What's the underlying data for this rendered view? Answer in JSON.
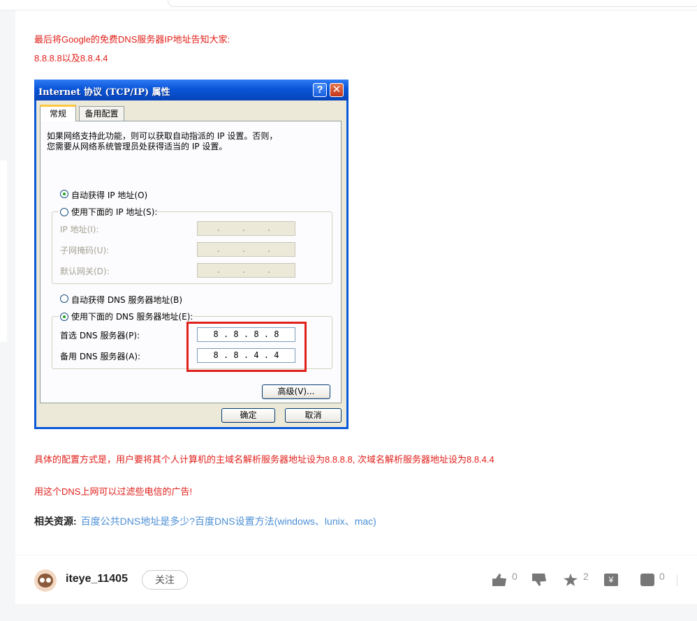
{
  "article": {
    "line1": "最后将Google的免费DNS服务器IP地址告知大家:",
    "line2": "8.8.8.8以及8.8.4.4",
    "line3": "具体的配置方式是，用户要将其个人计算机的主域名解析服务器地址设为8.8.8.8, 次域名解析服务器地址设为8.8.4.4",
    "line4": "用这个DNS上网可以过滤些电信的广告!",
    "related_label": "相关资源:",
    "related_link": "百度公共DNS地址是多少?百度DNS设置方法(windows、lunix、mac)"
  },
  "dialog": {
    "title": "Internet 协议 (TCP/IP) 属性",
    "help_glyph": "?",
    "close_glyph": "✕",
    "tab_general": "常规",
    "tab_alternate": "备用配置",
    "desc1": "如果网络支持此功能，则可以获取自动指派的 IP 设置。否则，",
    "desc2": "您需要从网络系统管理员处获得适当的 IP 设置。",
    "radio_auto_ip": "自动获得 IP 地址(O)",
    "radio_manual_ip": "使用下面的 IP 地址(S):",
    "label_ip": "IP 地址(I):",
    "label_mask": "子网掩码(U):",
    "label_gateway": "默认网关(D):",
    "empty_ip": " .    .    .  ",
    "radio_auto_dns": "自动获得 DNS 服务器地址(B)",
    "radio_manual_dns": "使用下面的 DNS 服务器地址(E):",
    "label_dns1": "首选 DNS 服务器(P):",
    "label_dns2": "备用 DNS 服务器(A):",
    "dns1_value": "8 . 8 . 8 . 8",
    "dns2_value": "8 . 8 . 4 . 4",
    "advanced_button": "高级(V)...",
    "ok_button": "确定",
    "cancel_button": "取消",
    "highlight_color": "#e0201b"
  },
  "author": {
    "username": "iteye_11405",
    "follow_label": "关注",
    "likes": "0",
    "favorites": "2",
    "comments": "0",
    "coin_glyph": "¥"
  }
}
